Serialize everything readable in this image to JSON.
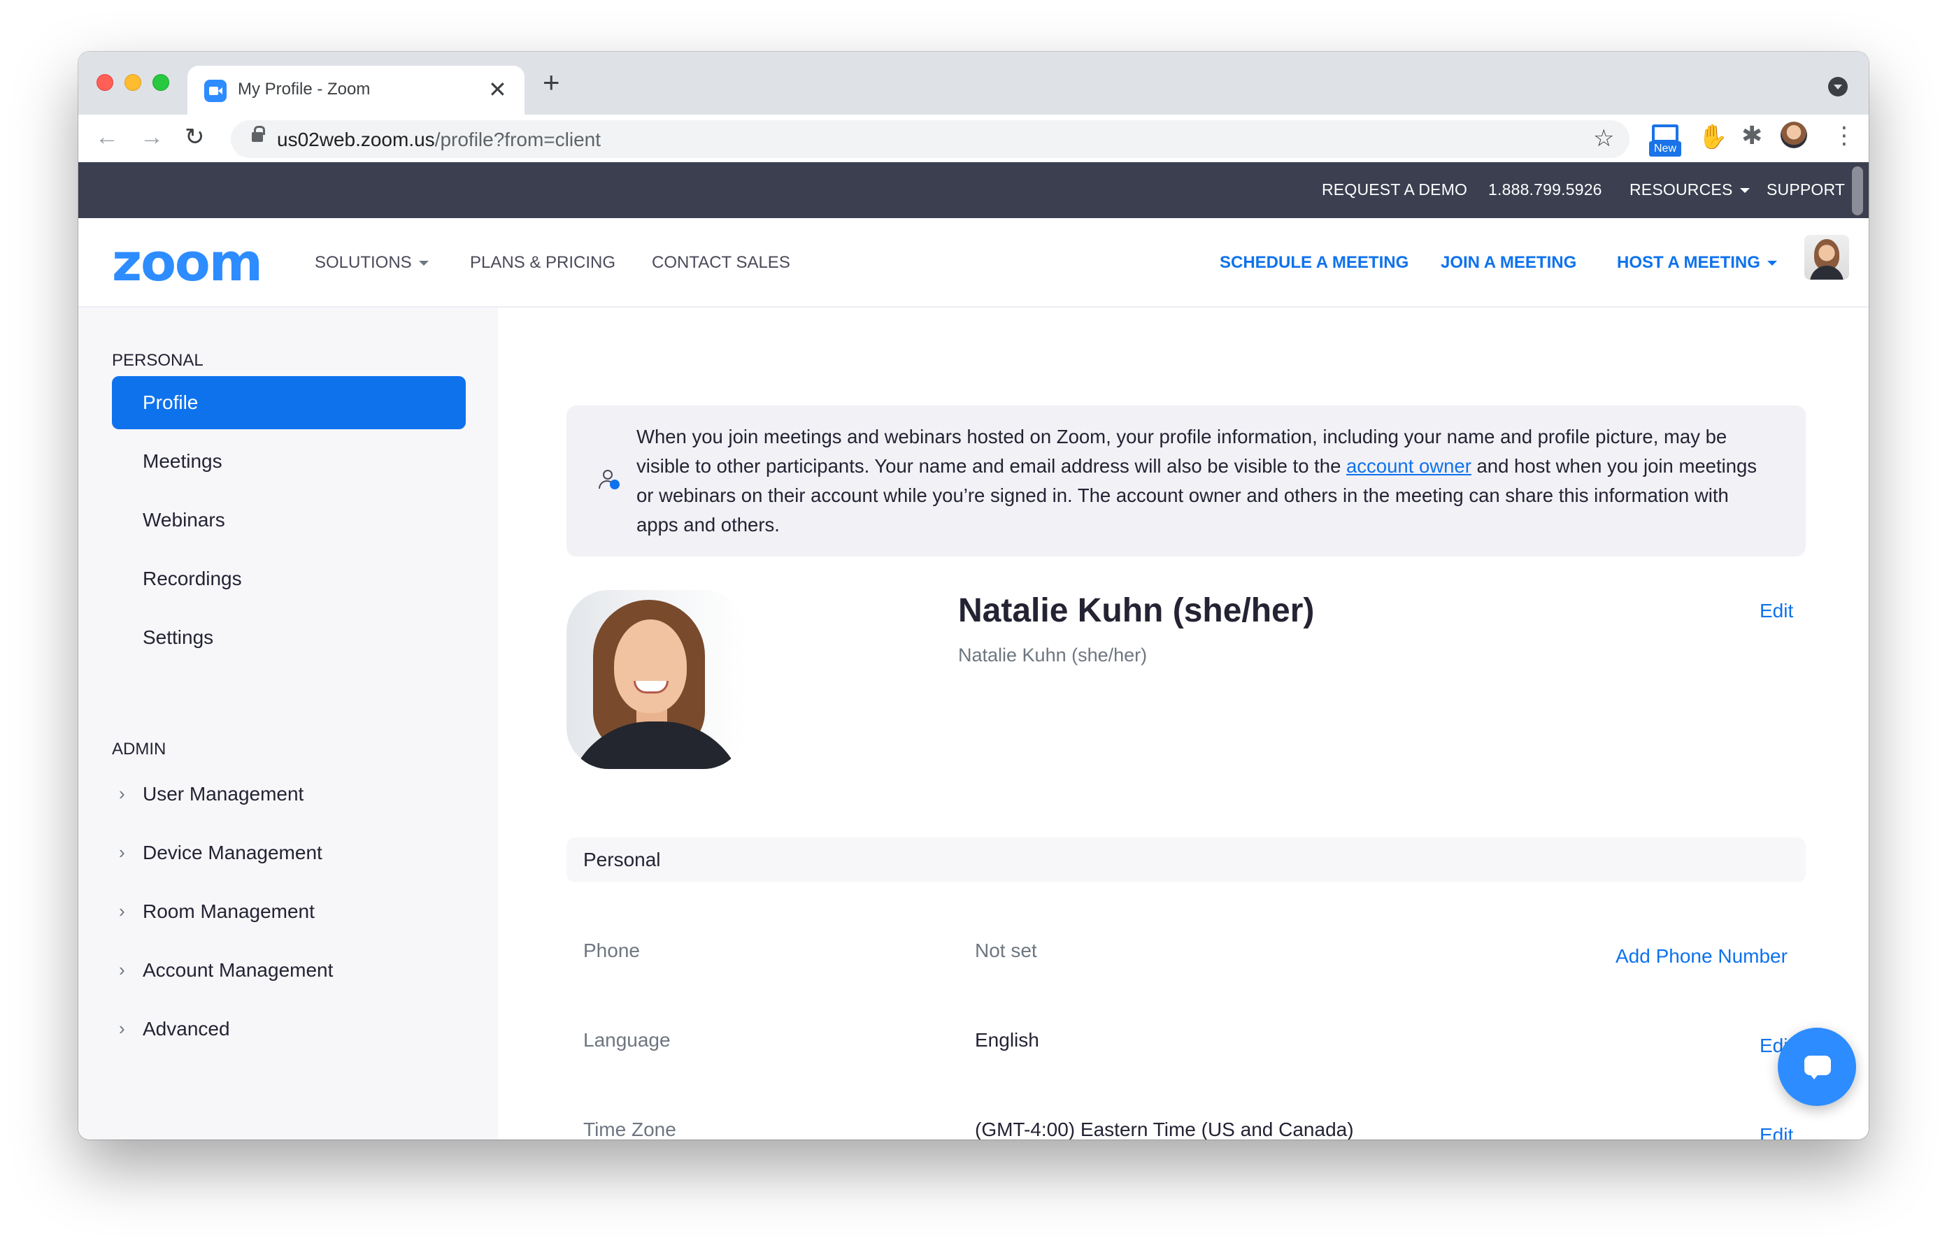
{
  "browser": {
    "tab_title": "My Profile - Zoom",
    "tab_close": "✕",
    "new_tab": "+",
    "url_host": "us02web.zoom.us",
    "url_path": "/profile?from=client",
    "ext_new_badge": "New"
  },
  "topbar": {
    "request_demo": "REQUEST A DEMO",
    "phone": "1.888.799.5926",
    "resources": "RESOURCES",
    "support": "SUPPORT"
  },
  "header": {
    "logo": "zoom",
    "solutions": "SOLUTIONS",
    "plans_pricing": "PLANS & PRICING",
    "contact_sales": "CONTACT SALES",
    "schedule_meeting": "SCHEDULE A MEETING",
    "join_meeting": "JOIN A MEETING",
    "host_meeting": "HOST A MEETING"
  },
  "sidebar": {
    "personal_label": "PERSONAL",
    "personal_items": [
      "Profile",
      "Meetings",
      "Webinars",
      "Recordings",
      "Settings"
    ],
    "admin_label": "ADMIN",
    "admin_items": [
      "User Management",
      "Device Management",
      "Room Management",
      "Account Management",
      "Advanced"
    ]
  },
  "notice": {
    "text_before": "When you join meetings and webinars hosted on Zoom, your profile information, including your name and profile picture, may be visible to other participants. Your name and email address will also be visible to the ",
    "link": "account owner",
    "text_after": " and host when you join meetings or webinars on their account while you’re signed in. The account owner and others in the meeting can share this information with apps and others."
  },
  "profile": {
    "name": "Natalie Kuhn (she/her)",
    "display_name": "Natalie Kuhn (she/her)",
    "edit": "Edit"
  },
  "personal_section": {
    "title": "Personal",
    "rows": [
      {
        "label": "Phone",
        "value": "Not set",
        "action": "Add Phone Number"
      },
      {
        "label": "Language",
        "value": "English",
        "action": "Edit"
      },
      {
        "label": "Time Zone",
        "value": "(GMT-4:00) Eastern Time (US and Canada)",
        "action": "Edit"
      }
    ]
  },
  "colors": {
    "accent": "#0e72ed",
    "topbar": "#3b3f50",
    "sidebar_bg": "#f7f7fa",
    "notice_bg": "#f1f1f6"
  }
}
